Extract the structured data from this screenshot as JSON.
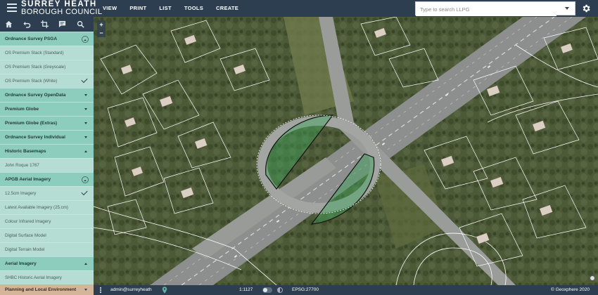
{
  "header": {
    "logo_line1": "SURREY HEATH",
    "logo_line2": "BOROUGH COUNCIL",
    "menu": [
      "VIEW",
      "PRINT",
      "LIST",
      "TOOLS",
      "CREATE"
    ],
    "search_placeholder": "Type to search LLPG"
  },
  "toolbar": {
    "icons": [
      "home-icon",
      "undo-icon",
      "crop-icon",
      "comment-icon",
      "search-icon"
    ]
  },
  "sidebar": {
    "groups": [
      {
        "label": "Ordnance Survey PSGA",
        "state": "expanded-circle",
        "items": [
          {
            "label": "OS Premium Stack (Standard)",
            "checked": false
          },
          {
            "label": "OS Premium Stack (Greyscale)",
            "checked": false
          },
          {
            "label": "OS Premium Stack (White)",
            "checked": true
          }
        ]
      },
      {
        "label": "Ordnance Survey OpenData",
        "state": "collapsed",
        "items": []
      },
      {
        "label": "Premium Globe",
        "state": "collapsed",
        "items": []
      },
      {
        "label": "Premium Globe (Extras)",
        "state": "collapsed",
        "items": []
      },
      {
        "label": "Ordnance Survey Individual",
        "state": "collapsed",
        "items": []
      },
      {
        "label": "Historic Basemaps",
        "state": "expanded",
        "items": [
          {
            "label": "John Roque 1767",
            "checked": false
          }
        ]
      },
      {
        "label": "APGB Aerial Imagery",
        "state": "expanded-circle",
        "items": [
          {
            "label": "12.5cm Imagery",
            "checked": true
          },
          {
            "label": "Latest Available Imagery (25.cm)",
            "checked": false
          },
          {
            "label": "Colour Infrared Imagery",
            "checked": false
          },
          {
            "label": "Digital Surface Model",
            "checked": false
          },
          {
            "label": "Digital Terrain Model",
            "checked": false
          }
        ]
      },
      {
        "label": "Aerial Imagery",
        "state": "expanded",
        "items": [
          {
            "label": "SHBC Historic Aerial Imagery",
            "checked": false
          }
        ]
      }
    ],
    "bottom_group": "Planning and Local Environment"
  },
  "map": {
    "zoom_in": "+",
    "zoom_out": "−"
  },
  "status": {
    "user": "admin@surreyheath",
    "scale": "1:1127",
    "epsg": "EPSG:27700",
    "copyright": "© Geoxphere 2020"
  },
  "colors": {
    "navbar": "#2c3e50",
    "sidebar_item": "#b6ddd4",
    "sidebar_header": "#8ccdbe",
    "roundabout_green": "#3fa35a"
  }
}
